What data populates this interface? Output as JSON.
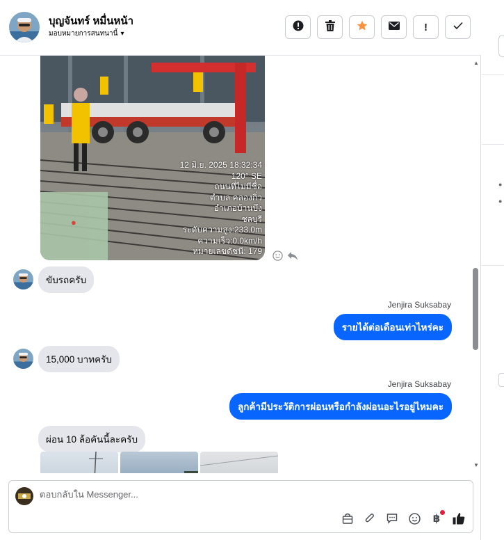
{
  "header": {
    "contact_name": "บุญจันทร์ หมื่นหน้า",
    "assignee_label": "มอบหมายการสนทนานี้",
    "actions": [
      {
        "name": "report-button",
        "icon": "alert-circle-icon"
      },
      {
        "name": "delete-button",
        "icon": "trash-icon"
      },
      {
        "name": "star-button",
        "icon": "star-icon"
      },
      {
        "name": "mark-unread-button",
        "icon": "envelope-icon"
      },
      {
        "name": "important-button",
        "icon": "exclamation-icon"
      },
      {
        "name": "done-button",
        "icon": "check-icon"
      }
    ]
  },
  "photo": {
    "stamp_lines": [
      "12 มิ.ย. 2025 18:32:34",
      "120° SE",
      "ถนนที่ไม่มีชื่อ",
      "ตำบล คลองกิ่ว",
      "อำเภอบ้านบึง",
      "ชลบุรี",
      "ระดับความสูง:233.0m",
      "ความเร็ว:0.0km/h",
      "หมายเลขดัชนี: 179"
    ]
  },
  "messages": [
    {
      "direction": "in",
      "text": "ขับรถครับ"
    },
    {
      "direction": "out",
      "sender": "Jenjira Suksabay",
      "text": "รายได้ต่อเดือนเท่าไหร่คะ"
    },
    {
      "direction": "in",
      "text": "15,000 บาทครับ"
    },
    {
      "direction": "out",
      "sender": "Jenjira Suksabay",
      "text": "ลูกค้ามีประวัติการผ่อนหรือกำลังผ่อนอะไรอยู่ไหมคะ"
    },
    {
      "direction": "in",
      "text": "ผ่อน 10 ล้อคันนี้ละครับ"
    }
  ],
  "composer": {
    "placeholder": "ตอบกลับใน Messenger...",
    "tools": [
      "bag-icon",
      "paperclip-icon",
      "chat-bubble-icon",
      "emoji-icon",
      "baht-icon",
      "thumbs-up-icon"
    ]
  },
  "colors": {
    "outgoing_bubble": "#0866ff",
    "incoming_bubble": "#e4e6eb",
    "star": "#f7923a"
  }
}
